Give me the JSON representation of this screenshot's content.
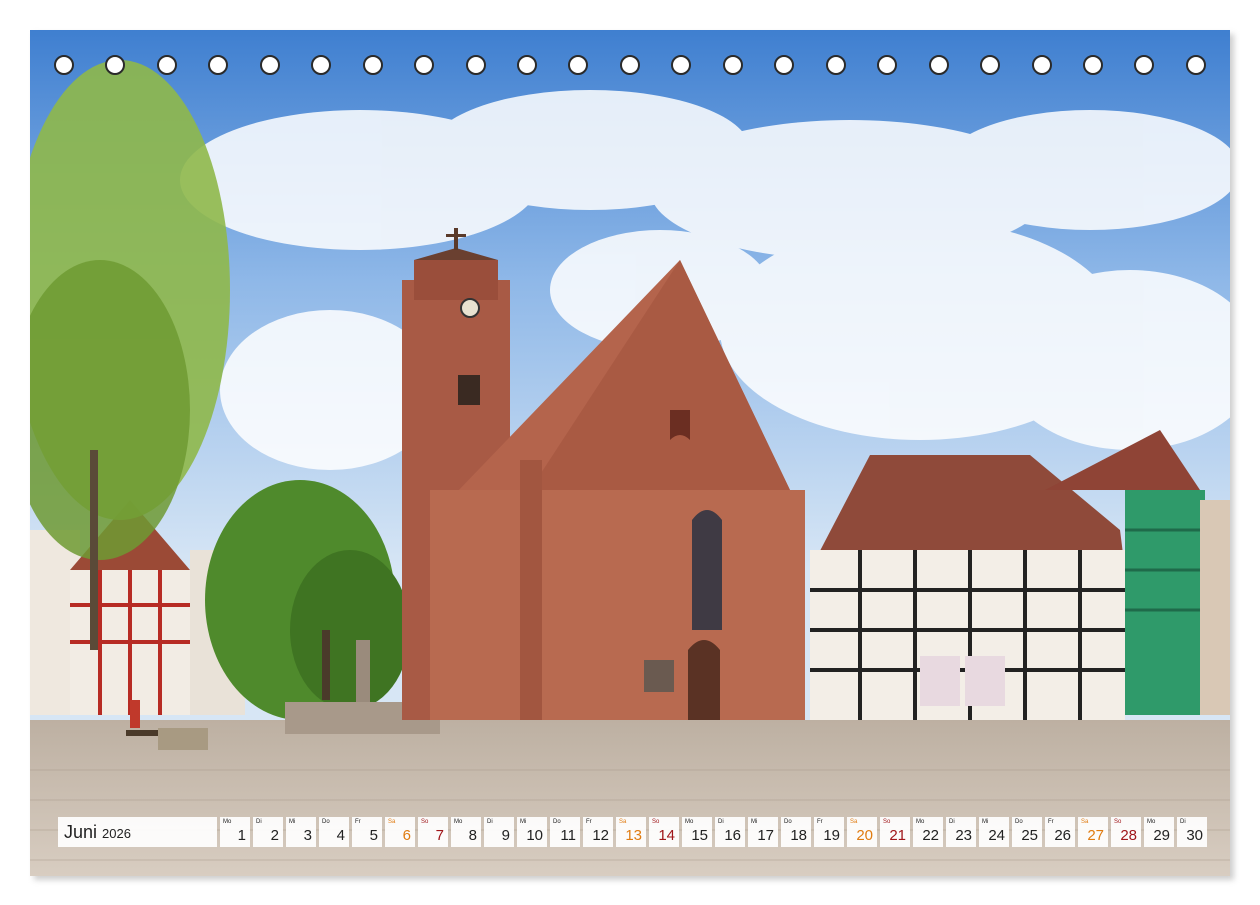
{
  "calendar": {
    "month": "Juni",
    "year": "2026",
    "days": [
      {
        "n": "1",
        "wd": "Mo",
        "t": "wk"
      },
      {
        "n": "2",
        "wd": "Di",
        "t": "wk"
      },
      {
        "n": "3",
        "wd": "Mi",
        "t": "wk"
      },
      {
        "n": "4",
        "wd": "Do",
        "t": "wk"
      },
      {
        "n": "5",
        "wd": "Fr",
        "t": "wk"
      },
      {
        "n": "6",
        "wd": "Sa",
        "t": "sat"
      },
      {
        "n": "7",
        "wd": "So",
        "t": "sun"
      },
      {
        "n": "8",
        "wd": "Mo",
        "t": "wk"
      },
      {
        "n": "9",
        "wd": "Di",
        "t": "wk"
      },
      {
        "n": "10",
        "wd": "Mi",
        "t": "wk"
      },
      {
        "n": "11",
        "wd": "Do",
        "t": "wk"
      },
      {
        "n": "12",
        "wd": "Fr",
        "t": "wk"
      },
      {
        "n": "13",
        "wd": "Sa",
        "t": "sat"
      },
      {
        "n": "14",
        "wd": "So",
        "t": "sun"
      },
      {
        "n": "15",
        "wd": "Mo",
        "t": "wk"
      },
      {
        "n": "16",
        "wd": "Di",
        "t": "wk"
      },
      {
        "n": "17",
        "wd": "Mi",
        "t": "wk"
      },
      {
        "n": "18",
        "wd": "Do",
        "t": "wk"
      },
      {
        "n": "19",
        "wd": "Fr",
        "t": "wk"
      },
      {
        "n": "20",
        "wd": "Sa",
        "t": "sat"
      },
      {
        "n": "21",
        "wd": "So",
        "t": "sun"
      },
      {
        "n": "22",
        "wd": "Mo",
        "t": "wk"
      },
      {
        "n": "23",
        "wd": "Di",
        "t": "wk"
      },
      {
        "n": "24",
        "wd": "Mi",
        "t": "wk"
      },
      {
        "n": "25",
        "wd": "Do",
        "t": "wk"
      },
      {
        "n": "26",
        "wd": "Fr",
        "t": "wk"
      },
      {
        "n": "27",
        "wd": "Sa",
        "t": "sat"
      },
      {
        "n": "28",
        "wd": "So",
        "t": "sun"
      },
      {
        "n": "29",
        "wd": "Mo",
        "t": "wk"
      },
      {
        "n": "30",
        "wd": "Di",
        "t": "wk"
      }
    ]
  },
  "colors": {
    "saturday": "#e07b10",
    "sunday": "#a0161a",
    "weekday": "#222222"
  }
}
